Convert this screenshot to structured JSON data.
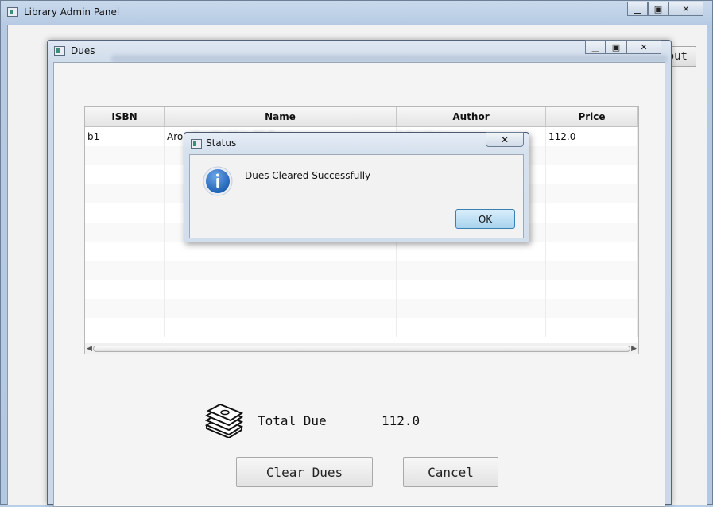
{
  "main_window": {
    "title": "Library Admin Panel",
    "logout_partial_label": "out"
  },
  "dues_window": {
    "title": "Dues",
    "table": {
      "columns": [
        "ISBN",
        "Name",
        "Author",
        "Price"
      ],
      "rows": [
        {
          "isbn": "b1",
          "name": "Arou",
          "author": "",
          "price": "112.0"
        }
      ]
    },
    "total_label": "Total Due",
    "total_value": "112.0",
    "clear_button": "Clear Dues",
    "cancel_button": "Cancel"
  },
  "status_dialog": {
    "title": "Status",
    "message": "Dues Cleared Successfully",
    "ok_button": "OK"
  },
  "colors": {
    "title_bar": "#c9d9ec",
    "ok_button": "#a8d3ee",
    "info_blue": "#2f6fc2"
  },
  "icons": {
    "info": "info-icon",
    "money": "money-stack-icon",
    "close": "close-icon",
    "maximize": "maximize-icon",
    "minimize": "minimize-icon"
  }
}
